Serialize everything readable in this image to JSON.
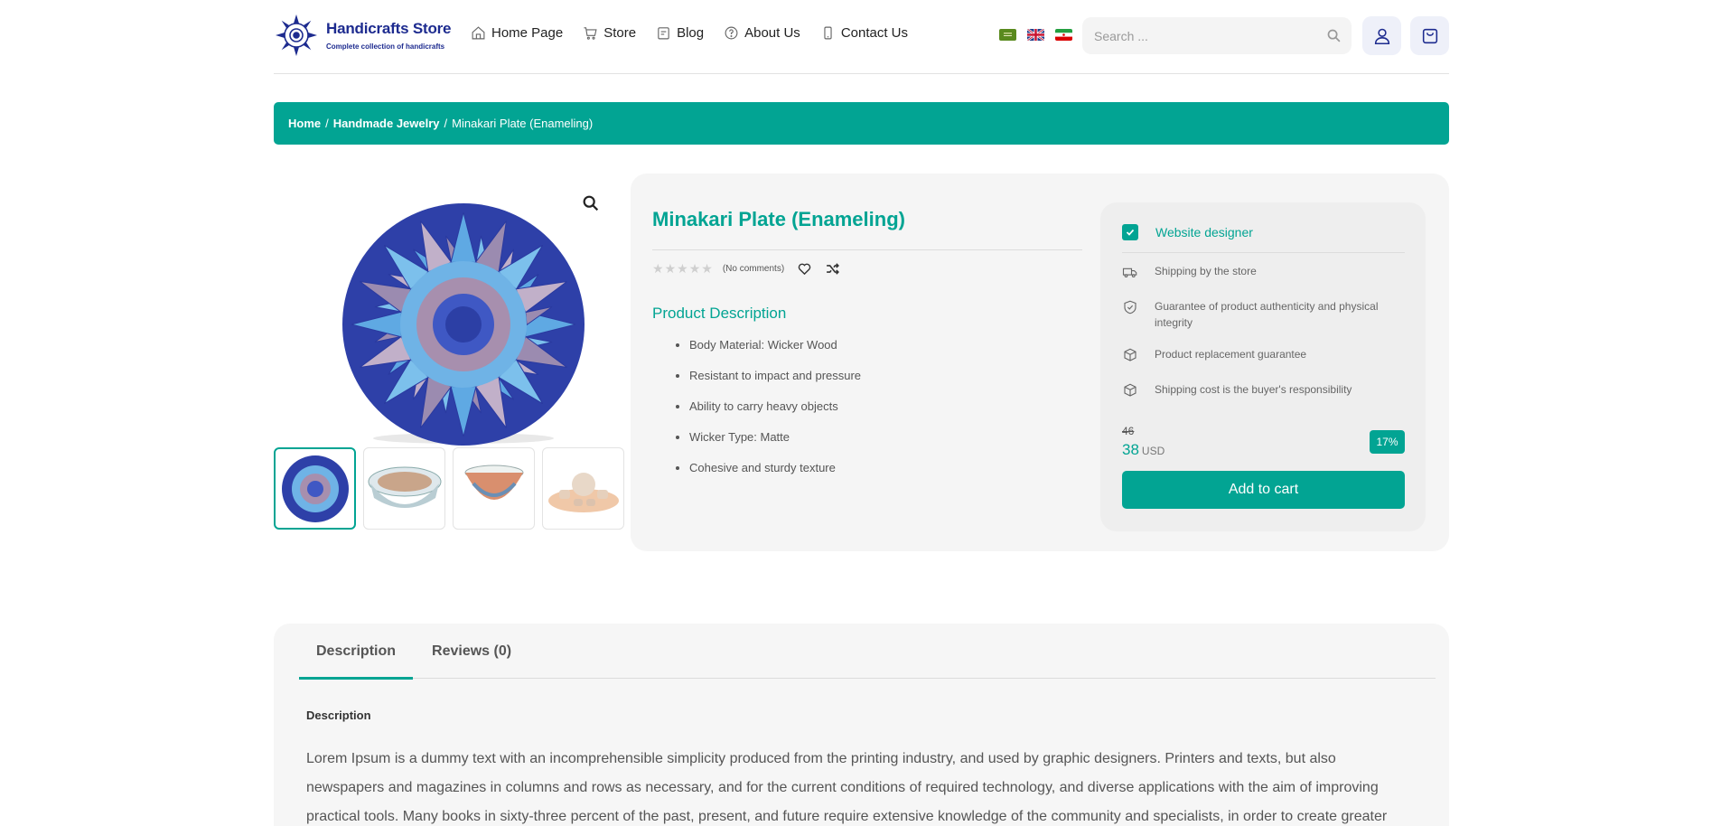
{
  "header": {
    "logo_title": "Handicrafts Store",
    "logo_subtitle": "Complete collection of handicrafts",
    "nav": [
      {
        "label": "Home Page",
        "icon": "home-icon"
      },
      {
        "label": "Store",
        "icon": "cart-icon"
      },
      {
        "label": "Blog",
        "icon": "blog-icon"
      },
      {
        "label": "About Us",
        "icon": "question-icon"
      },
      {
        "label": "Contact Us",
        "icon": "phone-icon"
      }
    ],
    "flags": [
      "flag-saudi",
      "flag-uk",
      "flag-iran"
    ],
    "search_placeholder": "Search ..."
  },
  "breadcrumb": {
    "home": "Home",
    "category": "Handmade Jewelry",
    "current": "Minakari Plate (Enameling)",
    "separator": "/"
  },
  "product": {
    "title": "Minakari Plate (Enameling)",
    "comments": "(No comments)",
    "rating": 0,
    "description_title": "Product Description",
    "features": [
      "Body Material: Wicker Wood",
      "Resistant to impact and pressure",
      "Ability to carry heavy objects",
      "Wicker Type: Matte",
      "Cohesive and sturdy texture"
    ]
  },
  "card": {
    "seller": "Website designer",
    "services": [
      "Shipping by the store",
      "Guarantee of product authenticity and physical integrity",
      "Product replacement guarantee",
      "Shipping cost is the buyer's responsibility"
    ],
    "old_price": "46",
    "new_price": "38",
    "currency": "USD",
    "discount": "17%",
    "add_to_cart": "Add to cart"
  },
  "tabs": {
    "items": [
      "Description",
      "Reviews (0)"
    ],
    "active": 0,
    "heading": "Description",
    "text": "Lorem Ipsum is a dummy text with an incomprehensible simplicity produced from the printing industry, and used by graphic designers. Printers and texts, but also newspapers and magazines in columns and rows as necessary, and for the current conditions of required technology, and diverse applications with the aim of improving practical tools. Many books in sixty-three percent of the past, present, and future require extensive knowledge of the community and specialists, in order to create greater"
  },
  "colors": {
    "accent": "#02a493",
    "brand": "#1d2b8f",
    "plate_blue": "#3b4fb5"
  }
}
